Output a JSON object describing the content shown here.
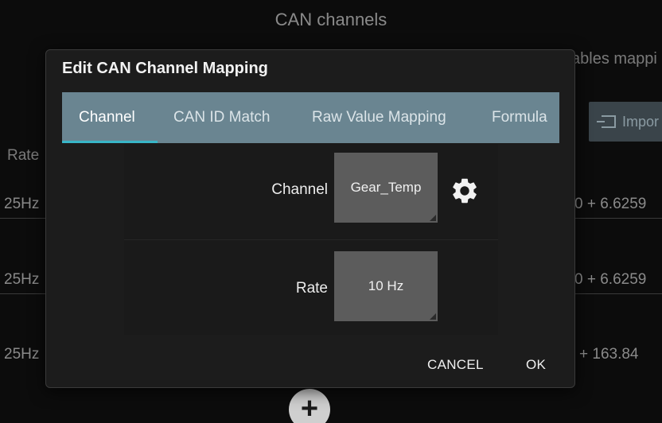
{
  "background": {
    "title": "CAN channels",
    "subtext": "ables mappi",
    "import_label": "Impor",
    "rate_header": "Rate",
    "rows": [
      {
        "rate": "25Hz",
        "formula": "0 + 6.6259"
      },
      {
        "rate": "25Hz",
        "formula": "0 + 6.6259"
      },
      {
        "rate": "25Hz",
        "formula": "+ 163.84"
      }
    ],
    "add_label": "+"
  },
  "dialog": {
    "title": "Edit CAN Channel Mapping",
    "tabs": [
      {
        "label": "Channel",
        "active": true
      },
      {
        "label": "CAN ID Match",
        "active": false
      },
      {
        "label": "Raw Value Mapping",
        "active": false
      },
      {
        "label": "Formula",
        "active": false
      }
    ],
    "channel_label": "Channel",
    "channel_value": "Gear_Temp",
    "rate_label": "Rate",
    "rate_value": "10 Hz",
    "cancel_label": "CANCEL",
    "ok_label": "OK"
  },
  "colors": {
    "tab_bar": "#6a8591",
    "tab_indicator": "#38b6c8",
    "dialog_bg": "#1c1c1c",
    "field_bg": "#5c5c5c"
  }
}
